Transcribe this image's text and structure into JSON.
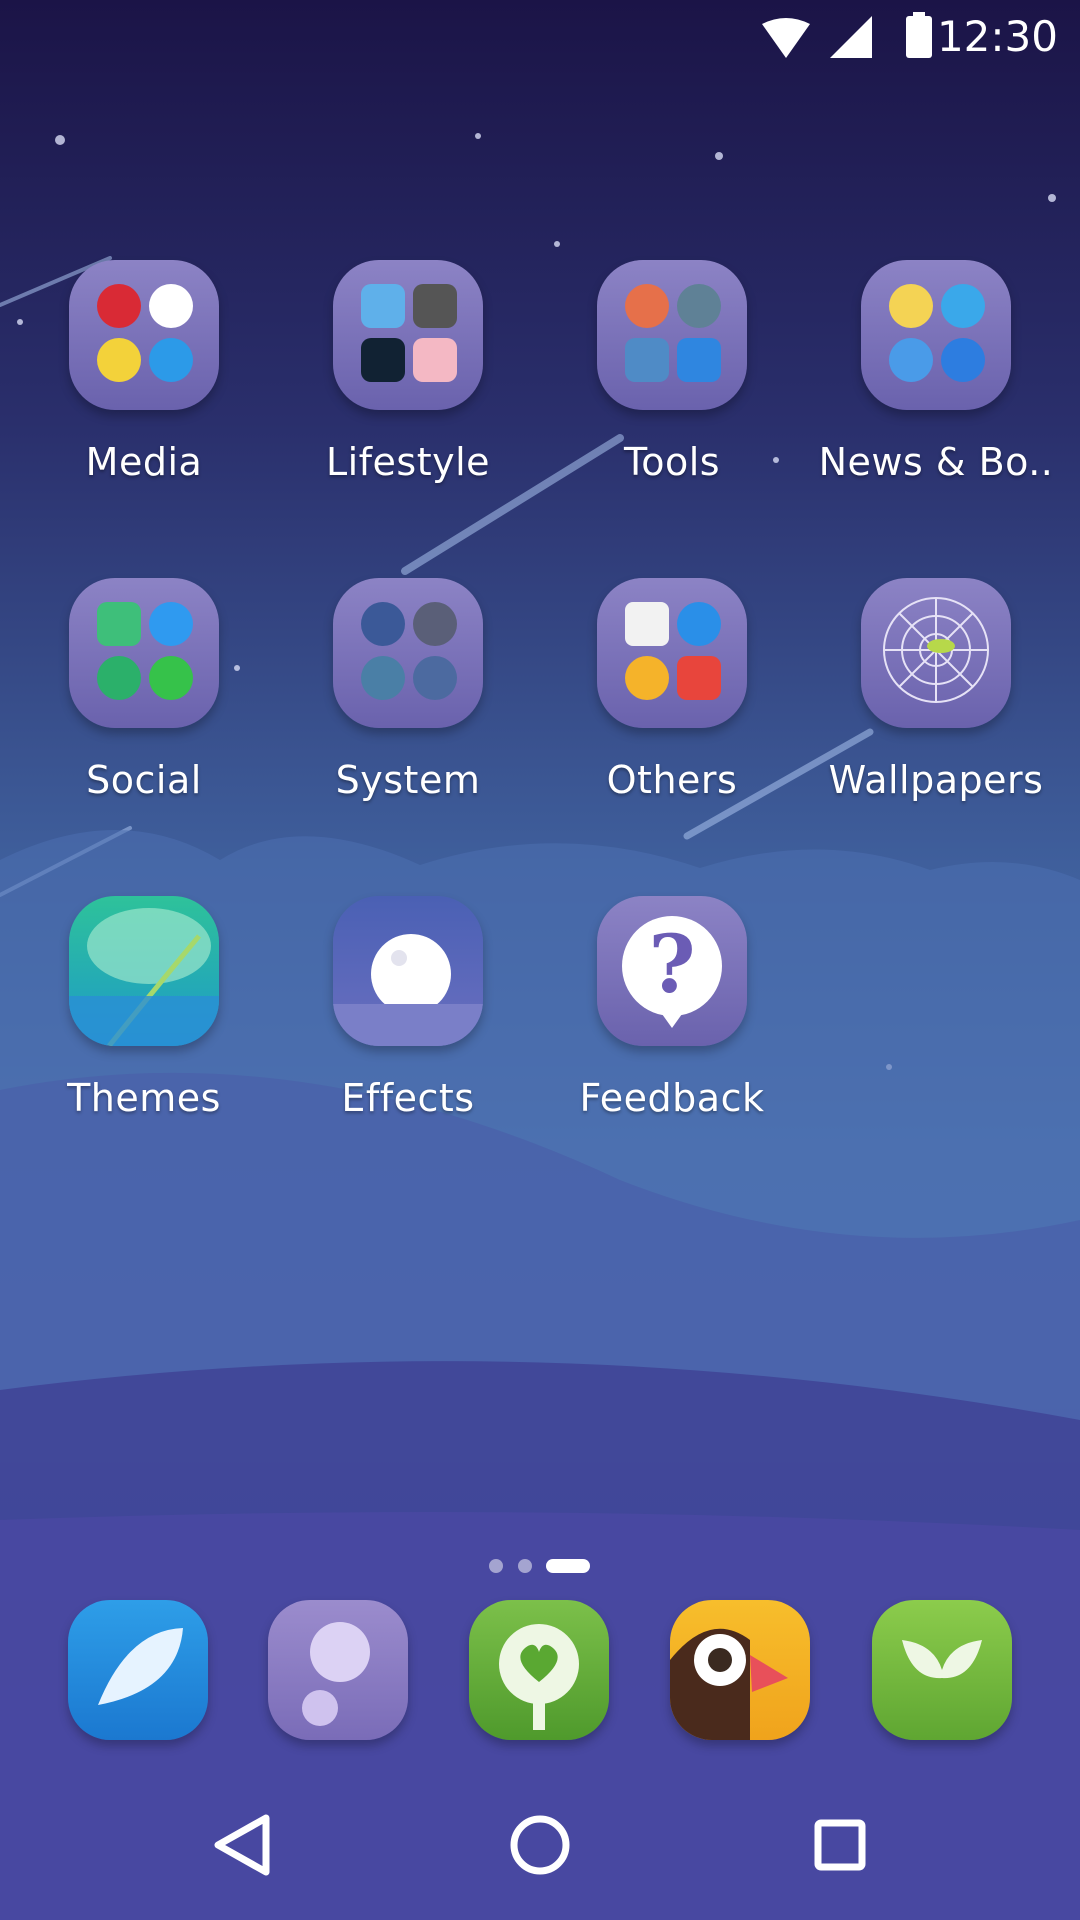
{
  "status_bar": {
    "time": "12:30"
  },
  "home": {
    "rows": [
      [
        {
          "label": "Media",
          "kind": "folder"
        },
        {
          "label": "Lifestyle",
          "kind": "folder"
        },
        {
          "label": "Tools",
          "kind": "folder"
        },
        {
          "label": "News & Bo..",
          "kind": "folder"
        }
      ],
      [
        {
          "label": "Social",
          "kind": "folder"
        },
        {
          "label": "System",
          "kind": "folder"
        },
        {
          "label": "Others",
          "kind": "folder"
        },
        {
          "label": "Wallpapers",
          "kind": "app"
        }
      ],
      [
        {
          "label": "Themes",
          "kind": "app"
        },
        {
          "label": "Effects",
          "kind": "app"
        },
        {
          "label": "Feedback",
          "kind": "app"
        }
      ]
    ]
  },
  "page_indicator": {
    "pages": 3,
    "current": 3
  },
  "dock": {
    "apps": [
      "shell-icon",
      "morning-glory-icon",
      "green-heart-icon",
      "bird-icon",
      "sprout-icon"
    ]
  },
  "nav": {
    "buttons": [
      "back",
      "home",
      "recents"
    ]
  },
  "colors": {
    "folder_tile": "#7e75bd",
    "accent_white": "#ffffff"
  }
}
